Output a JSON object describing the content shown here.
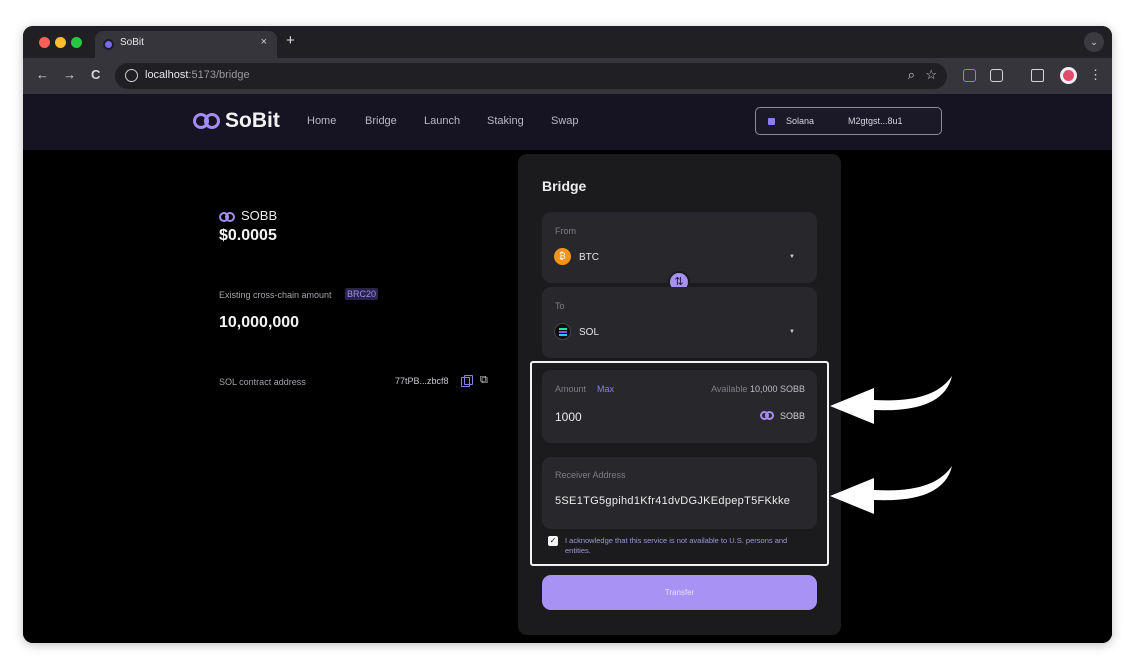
{
  "browser": {
    "tab_title": "SoBit",
    "tab_close": "×",
    "new_tab": "+",
    "tab_menu": "⌄",
    "back": "←",
    "forward": "→",
    "reload": "C",
    "url_host": "localhost",
    "url_rest": ":5173/bridge",
    "zoom_icon": "⌕",
    "star_icon": "☆",
    "menu_icon": "⋮"
  },
  "nav": {
    "brand": "SoBit",
    "links": [
      "Home",
      "Bridge",
      "Launch",
      "Staking",
      "Swap"
    ],
    "wallet_network": "Solana",
    "wallet_address": "M2gtgst...8u1"
  },
  "token": {
    "symbol": "SOBB",
    "price": "$0.0005",
    "cross_chain_label": "Existing cross-chain amount",
    "cross_chain_badge": "BRC20",
    "cross_chain_value": "10,000,000",
    "contract_label": "SOL contract address",
    "contract_value": "77tPB...zbcf8",
    "external_icon": "⧉"
  },
  "bridge": {
    "title": "Bridge",
    "from_label": "From",
    "from_chain": "BTC",
    "to_label": "To",
    "to_chain": "SOL",
    "caret": "▼",
    "swap_icon": "⇅",
    "amount_label": "Amount",
    "max_label": "Max",
    "available_label": "Available",
    "available_value": "10,000 SOBB",
    "amount_value": "1000",
    "amount_unit": "SOBB",
    "receiver_label": "Receiver Address",
    "receiver_value": "5SE1TG5gpihd1Kfr41dvDGJKEdpepT5FKkke",
    "ack_check": "✓",
    "ack_text": "I acknowledge that this service is not available to U.S. persons and entities.",
    "transfer_label": "Transfer"
  },
  "colors": {
    "accent": "#a690f3",
    "btc": "#f4931a",
    "page_bg": "#000000",
    "card_bg": "#1b1b1e"
  }
}
